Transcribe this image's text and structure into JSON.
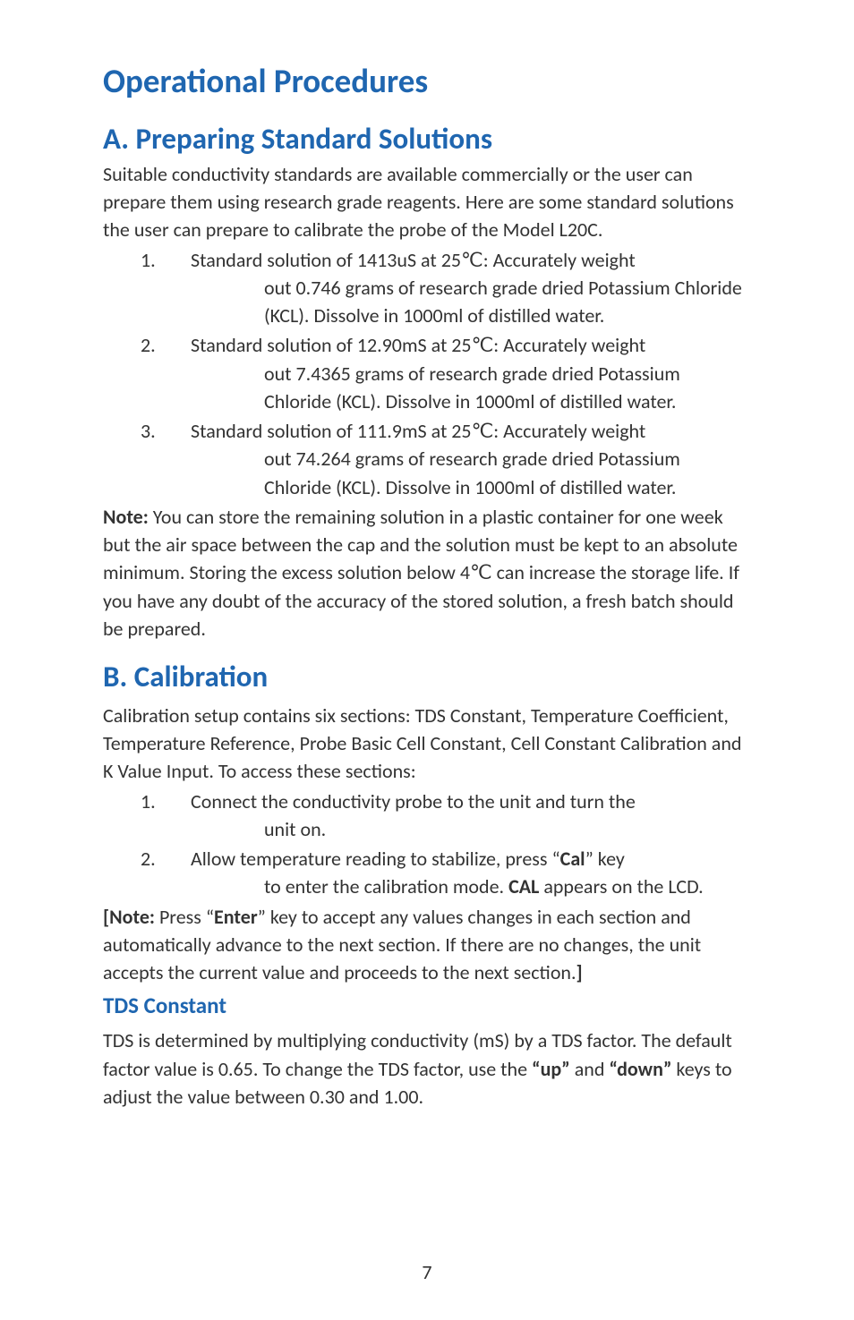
{
  "h1": "Operational Procedures",
  "sectionA": {
    "title": "A. Preparing Standard Solutions",
    "intro": "Suitable conductivity standards are available commercially or the user can prepare them using research grade reagents. Here are some standard solutions the user can prepare to calibrate the probe of the Model L20C.",
    "items": [
      {
        "num": "1.",
        "first": "Standard solution of 1413uS at 25℃: Accurately weight",
        "rest": "out 0.746 grams of research grade dried Potassium Chloride (KCL). Dissolve in 1000ml of distilled water."
      },
      {
        "num": "2.",
        "first": "Standard solution of 12.90mS at 25℃: Accurately weight",
        "rest": "out 7.4365 grams of research grade dried Potassium Chloride (KCL). Dissolve in 1000ml of distilled water."
      },
      {
        "num": "3.",
        "first": "Standard solution of 111.9mS at 25℃: Accurately weight",
        "rest": "out 74.264 grams of research grade dried Potassium Chloride (KCL). Dissolve in 1000ml of distilled water."
      }
    ],
    "note_label": "Note:",
    "note_body": " You can store the remaining solution in a plastic container for one week but the air space between the cap and the solution must be kept to an absolute minimum. Storing the excess solution below 4℃ can increase the storage life. If you have any doubt of the accuracy of the stored solution, a fresh batch should be prepared."
  },
  "sectionB": {
    "title": "B. Calibration",
    "intro": "Calibration setup contains six sections: TDS Constant, Temperature Coefficient, Temperature Reference, Probe Basic Cell Constant, Cell Constant Calibration and K Value Input. To access these sections:",
    "items": [
      {
        "num": "1.",
        "first": "Connect the conductivity probe to the unit and turn the",
        "rest": "unit on."
      },
      {
        "num": "2.",
        "first_pre": "Allow temperature reading to stabilize, press ",
        "first_q1": "“",
        "first_key": "Cal",
        "first_q2": "”",
        "first_post": " key",
        "rest_pre": "to enter the calibration mode. ",
        "rest_bold": "CAL",
        "rest_post": " appears on the LCD."
      }
    ],
    "note_open": "[Note:",
    "note_mid1": " Press ",
    "note_q1": "“",
    "note_key": "Enter",
    "note_q2": "”",
    "note_mid2": " key to accept any values changes in each section and automatically advance to the next section. If there are no changes, the unit accepts the current value and proceeds to the next section.",
    "note_close": "]"
  },
  "tds": {
    "title": "TDS Constant",
    "p_pre": "TDS is determined by multiplying conductivity (mS) by a TDS factor. The default factor value is 0.65. To change the TDS factor, use the ",
    "up": "“up”",
    "mid": " and ",
    "down": "“down”",
    "post": " keys to adjust the value between 0.30 and 1.00."
  },
  "page_number": "7"
}
